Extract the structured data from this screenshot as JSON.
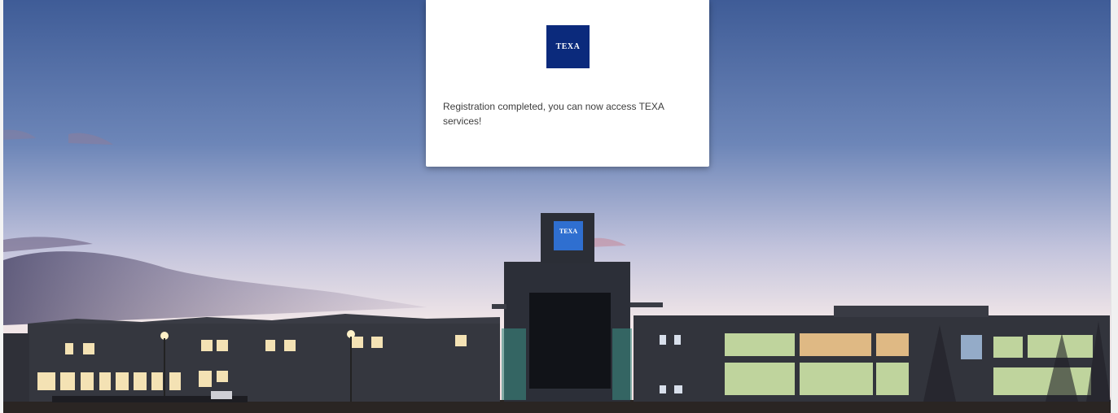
{
  "card": {
    "logo_text": "TEXA",
    "message": "Registration completed, you can now access TEXA services!"
  },
  "background": {
    "building_sign_text": "TEXA",
    "sky_top": "#3f5c97",
    "sky_horizon": "#f1e6e8",
    "brand_color": "#0b2a7c"
  }
}
